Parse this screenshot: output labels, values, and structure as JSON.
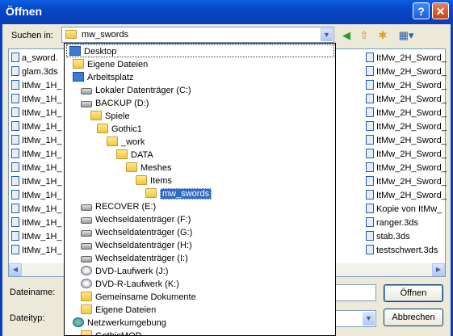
{
  "window": {
    "title": "Öffnen",
    "help_label": "?",
    "close_label": "✕"
  },
  "lookin": {
    "label": "Suchen in:",
    "value": "mw_swords"
  },
  "toolbar": {
    "back_icon": "back-icon",
    "up_icon": "up-folder-icon",
    "newfolder_icon": "new-folder-icon",
    "views_icon": "views-menu-icon"
  },
  "files_left": [
    "a_sword.",
    "glam.3ds",
    "ItMw_1H_",
    "ItMw_1H_",
    "ItMw_1H_",
    "ItMw_1H_",
    "ItMw_1H_",
    "ItMw_1H_",
    "ItMw_1H_",
    "ItMw_1H_",
    "ItMw_1H_",
    "ItMw_1H_",
    "ItMw_1H_",
    "ItMw_1H_",
    "ItMw_1H_"
  ],
  "files_right": [
    "ItMw_2H_Sword_",
    "ItMw_2H_Sword_",
    "ItMw_2H_Sword_",
    "ItMw_2H_Sword_",
    "ItMw_2H_Sword_",
    "ItMw_2H_Sword_",
    "ItMw_2H_Sword_",
    "ItMw_2H_Sword_",
    "ItMw_2H_Sword_",
    "ItMw_2H_Sword_",
    "ItMw_2H_Sword_",
    "Kopie von ItMw_",
    "ranger.3ds",
    "stab.3ds",
    "testschwert.3ds"
  ],
  "dropdown": [
    {
      "label": "Desktop",
      "icon": "desk"
    },
    {
      "label": "Eigene Dateien",
      "icon": "folder"
    },
    {
      "label": "Arbeitsplatz",
      "icon": "desk"
    },
    {
      "label": "Lokaler Datenträger (C:)",
      "icon": "drive"
    },
    {
      "label": "BACKUP (D:)",
      "icon": "drive"
    },
    {
      "label": "Spiele",
      "icon": "folder"
    },
    {
      "label": "Gothic1",
      "icon": "folder"
    },
    {
      "label": "_work",
      "icon": "folder"
    },
    {
      "label": "DATA",
      "icon": "folder"
    },
    {
      "label": "Meshes",
      "icon": "folder"
    },
    {
      "label": "Items",
      "icon": "folder"
    },
    {
      "label": "mw_swords",
      "icon": "folder"
    },
    {
      "label": "RECOVER (E:)",
      "icon": "drive"
    },
    {
      "label": "Wechseldatenträger (F:)",
      "icon": "drive"
    },
    {
      "label": "Wechseldatenträger (G:)",
      "icon": "drive"
    },
    {
      "label": "Wechseldatenträger (H:)",
      "icon": "drive"
    },
    {
      "label": "Wechseldatenträger (I:)",
      "icon": "drive"
    },
    {
      "label": "DVD-Laufwerk (J:)",
      "icon": "disc"
    },
    {
      "label": "DVD-R-Laufwerk (K:)",
      "icon": "disc"
    },
    {
      "label": "Gemeinsame Dokumente",
      "icon": "folder"
    },
    {
      "label": "Eigene Dateien",
      "icon": "folder"
    },
    {
      "label": "Netzwerkumgebung",
      "icon": "net"
    },
    {
      "label": "GothicMOD",
      "icon": "folder"
    }
  ],
  "filename": {
    "label": "Dateiname:",
    "value": ""
  },
  "filetype": {
    "label": "Dateityp:",
    "value": ""
  },
  "buttons": {
    "open": "Öffnen",
    "cancel": "Abbrechen"
  }
}
